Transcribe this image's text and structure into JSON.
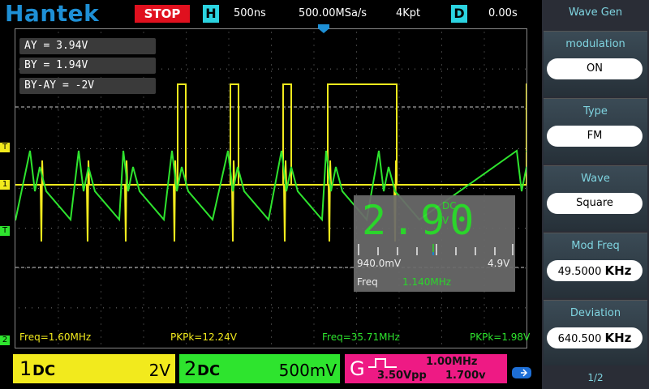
{
  "header": {
    "logo": "Hantek",
    "run_state": "STOP",
    "h_icon": "H",
    "timebase": "500ns",
    "sample_rate": "500.00MSa/s",
    "memory_depth": "4Kpt",
    "d_icon": "D",
    "delay": "0.00s"
  },
  "cursors": {
    "ay": "AY    = 3.94V",
    "by": "BY    = 1.94V",
    "delta": "BY-AY = -2V"
  },
  "markers": {
    "trigger_1": "T",
    "ch1": "1",
    "trigger_2": "T",
    "ch2": "2"
  },
  "meter": {
    "value": "2.90",
    "coupling": "DC",
    "unit": "V",
    "range_min": "940.0mV",
    "range_max": "4.9V",
    "freq_label": "Freq",
    "freq_value": "1.140MHz"
  },
  "measurements": {
    "ch1_freq": "Freq=1.60MHz",
    "ch1_pkpk": "PKPk=12.24V",
    "ch2_freq": "Freq=35.71MHz",
    "ch2_pkpk": "PKPk=1.98V"
  },
  "channels": {
    "ch1": {
      "num": "1",
      "coupling": "DC",
      "scale": "2V",
      "color": "#f2ea1d"
    },
    "ch2": {
      "num": "2",
      "coupling": "DC",
      "scale": "500mV",
      "color": "#2ee42e"
    },
    "gen": {
      "label": "G",
      "freq": "1.00MHz",
      "amp": "3.50Vpp",
      "offset": "1.700v",
      "color": "#ee1a84"
    }
  },
  "sidebar": {
    "title": "Wave Gen",
    "panels": [
      {
        "title": "modulation",
        "value": "ON"
      },
      {
        "title": "Type",
        "value": "FM"
      },
      {
        "title": "Wave",
        "value": "Square"
      },
      {
        "title": "Mod Freq",
        "value": "49.5000",
        "unit": "KHz"
      },
      {
        "title": "Deviation",
        "value": "640.500",
        "unit": "KHz"
      }
    ],
    "page": "1/2"
  }
}
